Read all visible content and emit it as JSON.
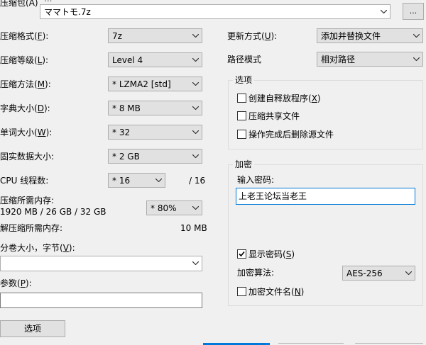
{
  "archive": {
    "label_text": "压缩包",
    "label_key": "(A)",
    "path_partial": "...",
    "filename": "ママトモ.7z",
    "browse_label": "..."
  },
  "left": {
    "format": {
      "label": "压缩格式(",
      "key": "F",
      "suffix": "):",
      "value": "7z"
    },
    "level": {
      "label": "压缩等级(",
      "key": "L",
      "suffix": "):",
      "value": "Level 4"
    },
    "method": {
      "label": "压缩方法(",
      "key": "M",
      "suffix": "):",
      "value": "*  LZMA2 [std]"
    },
    "dict": {
      "label": "字典大小(",
      "key": "D",
      "suffix": "):",
      "value": "*  8 MB"
    },
    "word": {
      "label": "单词大小(",
      "key": "W",
      "suffix": "):",
      "value": "*  32"
    },
    "solid": {
      "label": "固实数据大小:",
      "value": "*  2 GB"
    },
    "cpu": {
      "label": "CPU 线程数:",
      "value": "*  16",
      "max": "/ 16"
    },
    "mem_compress": {
      "label": "压缩所需内存:",
      "detail": "1920 MB / 26 GB / 32 GB",
      "value": "* 80%"
    },
    "mem_decompress": {
      "label": "解压缩所需内存:",
      "value": "10 MB"
    },
    "volume": {
      "label": "分卷大小，字节(",
      "key": "V",
      "suffix": "):",
      "value": ""
    },
    "params": {
      "label": "参数(",
      "key": "P",
      "suffix": "):",
      "value": ""
    },
    "options_button": "选项"
  },
  "right": {
    "update": {
      "label": "更新方式(",
      "key": "U",
      "suffix": "):",
      "value": "添加并替换文件"
    },
    "pathmode": {
      "label": "路径模式",
      "value": "相对路径"
    },
    "options_group": {
      "title": "选项",
      "sfx": {
        "label": "创建自释放程序(",
        "key": "X",
        "suffix": ")",
        "checked": false
      },
      "shared": {
        "label": "压缩共享文件",
        "checked": false
      },
      "delete": {
        "label": "操作完成后删除源文件",
        "checked": false
      }
    },
    "encrypt_group": {
      "title": "加密",
      "password_label": "输入密码:",
      "password_value": "上老王论坛当老王",
      "show_password": {
        "label": "显示密码(",
        "key": "S",
        "suffix": ")",
        "checked": true
      },
      "method_label": "加密算法:",
      "method_value": "AES-256",
      "encrypt_names": {
        "label": "加密文件名(",
        "key": "N",
        "suffix": ")",
        "checked": false
      }
    }
  },
  "colors": {
    "accent": "#0078d7",
    "window_bg": "#f0f0f0",
    "border": "#adadad"
  }
}
